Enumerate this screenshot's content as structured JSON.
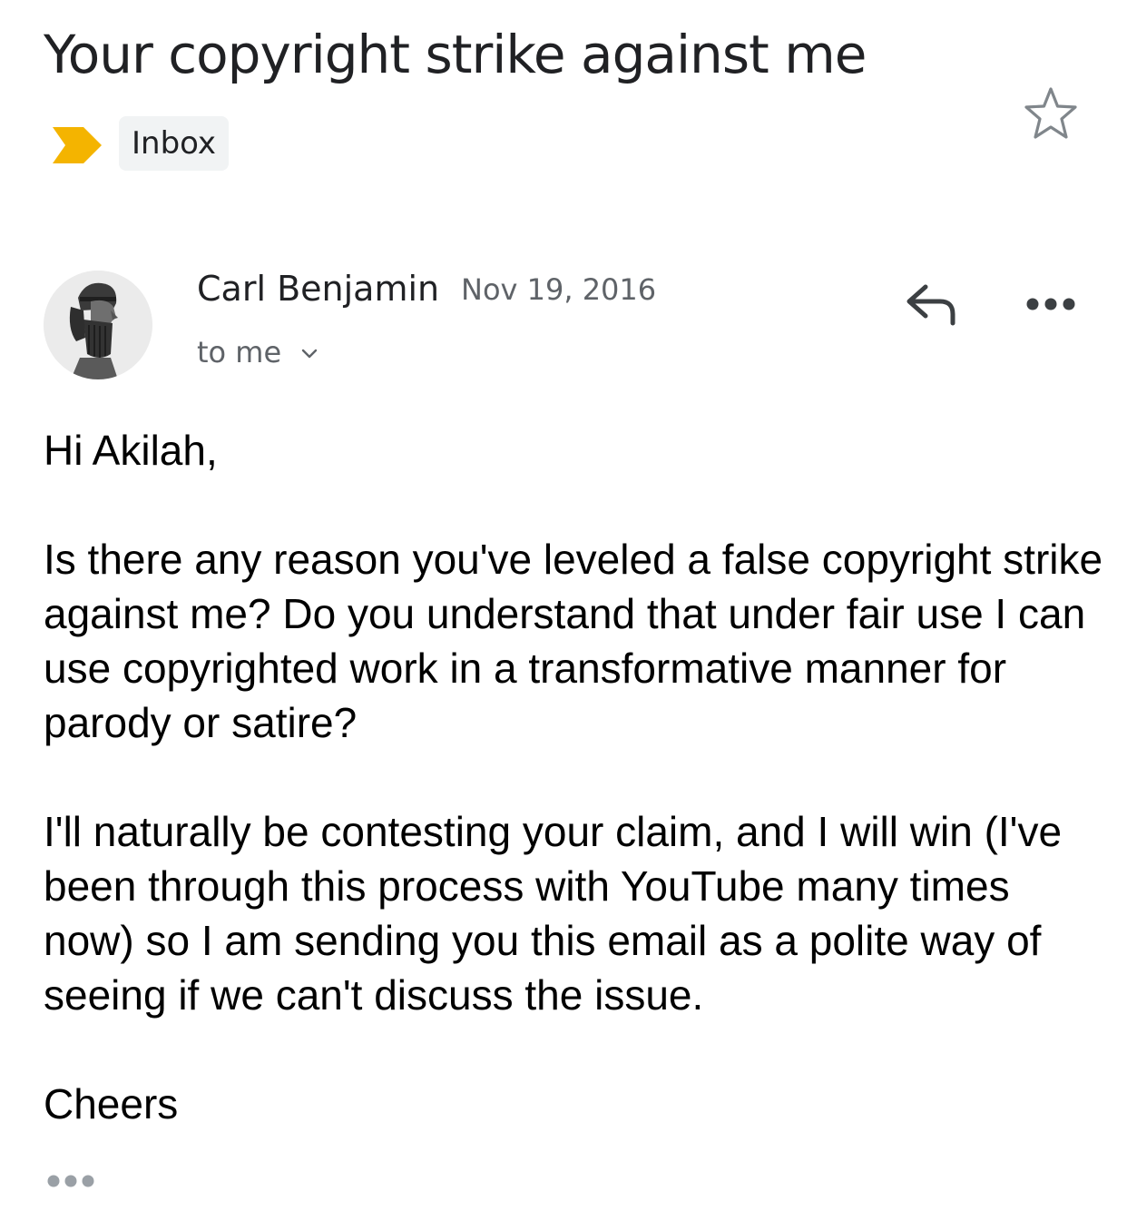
{
  "email": {
    "subject": "Your copyright strike against me",
    "label": "Inbox",
    "importance_marker_color": "#f4b400",
    "starred": false
  },
  "message": {
    "sender_name": "Carl Benjamin",
    "date": "Nov 19, 2016",
    "recipients": "to me",
    "avatar": "bust-portrait",
    "body": {
      "greeting": "Hi Akilah,",
      "paragraph1": "Is there any reason you've leveled a false copyright strike against me?  Do you understand that under fair use I can use copyrighted work in a transformative manner for parody or satire?",
      "paragraph2": "I'll naturally be contesting your claim, and I will win (I've been through this process with YouTube many times now) so I am sending you this email as a polite way of seeing if we can't discuss the issue.",
      "signoff": "Cheers"
    }
  },
  "icons": {
    "star": "star-outline-icon",
    "reply": "reply-arrow-icon",
    "more": "more-horizontal-icon",
    "expand_recipients": "chevron-down-icon",
    "show_trimmed": "ellipsis-icon"
  }
}
